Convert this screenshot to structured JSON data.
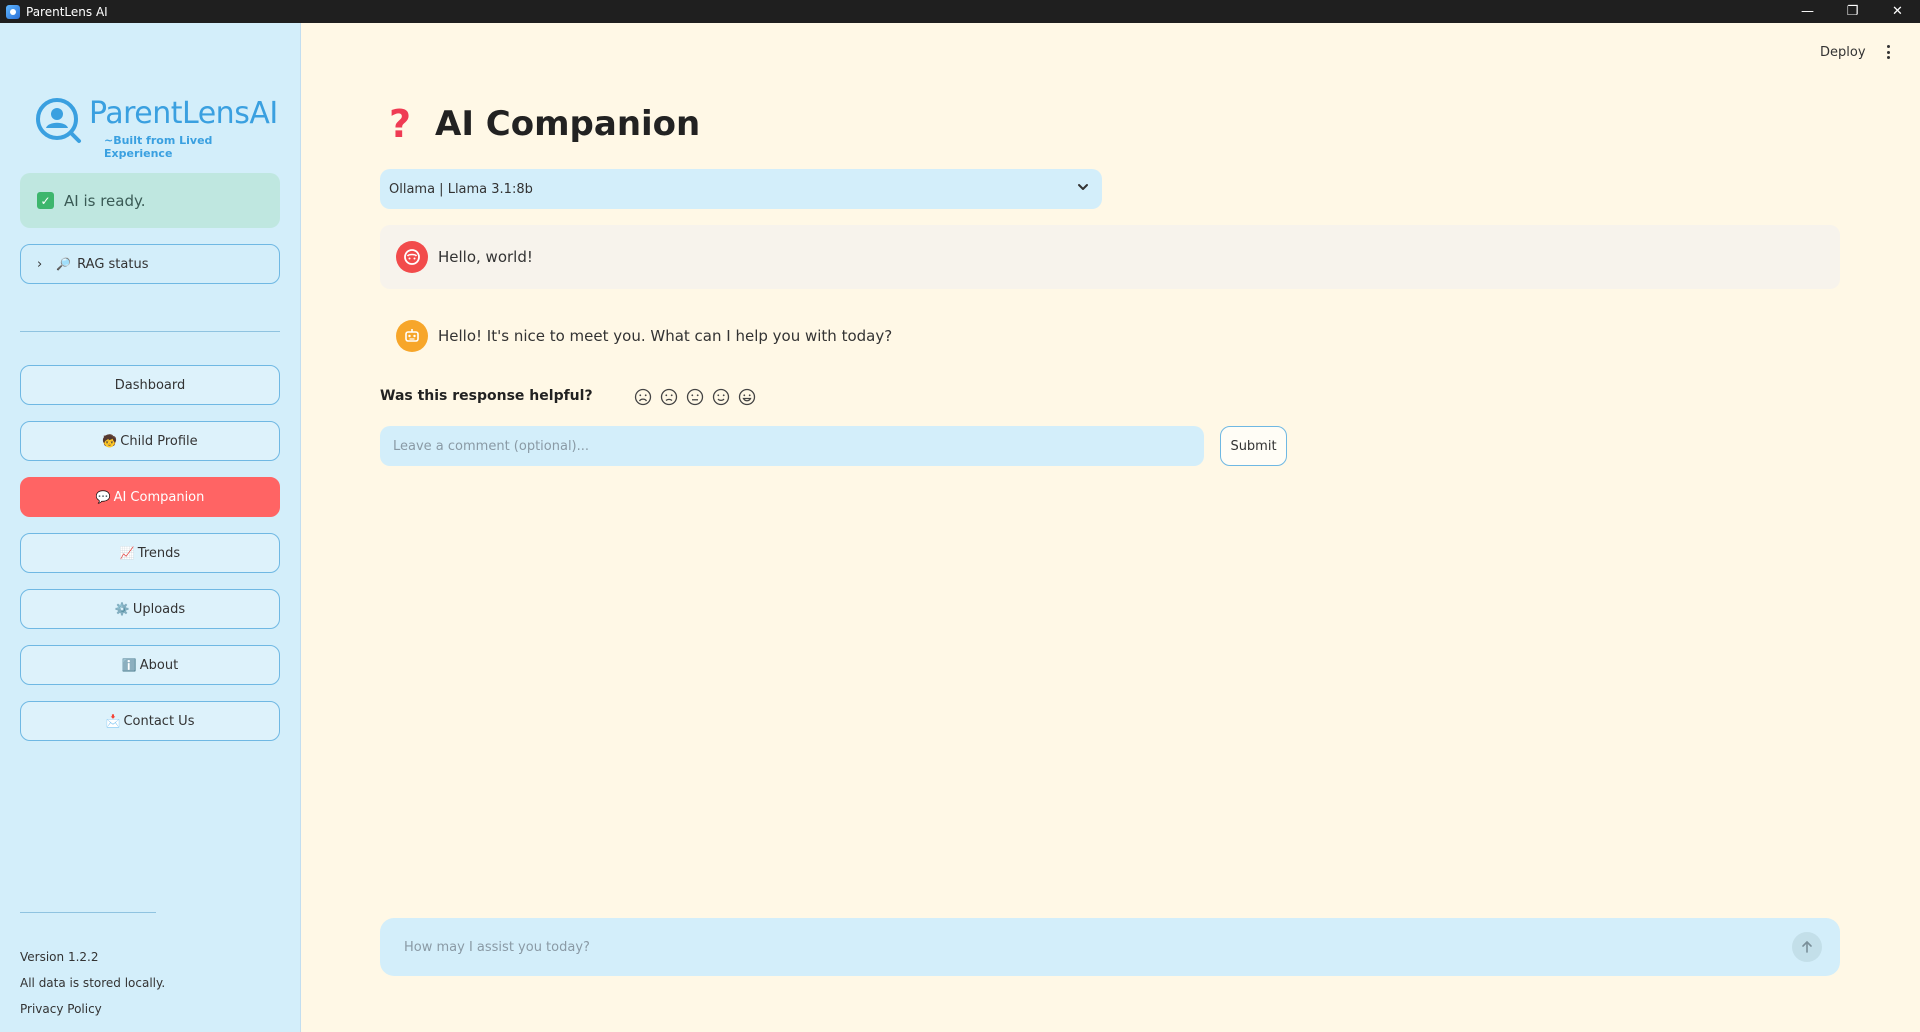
{
  "window": {
    "title": "ParentLens AI",
    "controls": [
      "—",
      "❐",
      "✕"
    ]
  },
  "sidebar": {
    "logo_text": "ParentLensAI",
    "logo_tagline": "~Built from Lived Experience",
    "ai_status": "AI is ready.",
    "rag_label": "RAG status",
    "nav": [
      {
        "emoji": "",
        "label": "Dashboard",
        "active": false
      },
      {
        "emoji": "🧒",
        "label": "Child Profile",
        "active": false
      },
      {
        "emoji": "💬",
        "label": "AI Companion",
        "active": true
      },
      {
        "emoji": "📈",
        "label": "Trends",
        "active": false
      },
      {
        "emoji": "⚙️",
        "label": "Uploads",
        "active": false
      },
      {
        "emoji": "ℹ️",
        "label": "About",
        "active": false
      },
      {
        "emoji": "📩",
        "label": "Contact Us",
        "active": false
      }
    ],
    "footer": {
      "version": "Version 1.2.2",
      "storage_note": "All data is stored locally.",
      "privacy": "Privacy Policy"
    }
  },
  "header": {
    "deploy": "Deploy"
  },
  "main": {
    "title_icon": "?",
    "title": "AI Companion",
    "model_select": "Ollama | Llama 3.1:8b",
    "messages": [
      {
        "role": "user",
        "text": "Hello, world!"
      },
      {
        "role": "assistant",
        "text": "Hello! It's nice to meet you. What can I help you with today?"
      }
    ],
    "feedback": {
      "prompt": "Was this response helpful?",
      "comment_placeholder": "Leave a comment (optional)...",
      "submit": "Submit"
    },
    "chat_placeholder": "How may I assist you today?"
  },
  "colors": {
    "sidebar_bg": "#d3eefa",
    "main_bg": "#fff8e6",
    "accent": "#ff6464",
    "brand_blue": "#3aa0e0"
  }
}
